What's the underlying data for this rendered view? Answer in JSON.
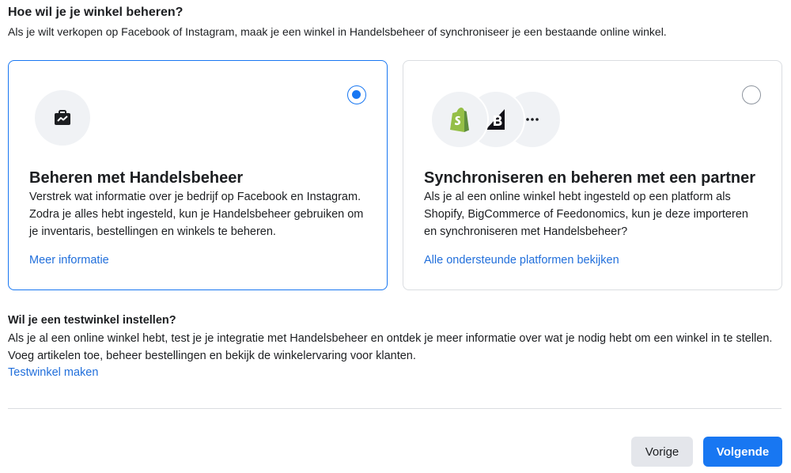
{
  "header": {
    "title": "Hoe wil je je winkel beheren?",
    "subtitle": "Als je wilt verkopen op Facebook of Instagram, maak je een winkel in Handelsbeheer of synchroniseer je een bestaande online winkel."
  },
  "options": [
    {
      "title": "Beheren met Handelsbeheer",
      "description": "Verstrek wat informatie over je bedrijf op Facebook en Instagram. Zodra je alles hebt ingesteld, kun je Handelsbeheer gebruiken om je inventaris, bestellingen en winkels te beheren.",
      "link": "Meer informatie",
      "selected": true
    },
    {
      "title": "Synchroniseren en beheren met een partner",
      "description": "Als je al een online winkel hebt ingesteld op een platform als Shopify, BigCommerce of Feedonomics, kun je deze importeren en synchroniseren met Handelsbeheer?",
      "link": "Alle ondersteunde platformen bekijken",
      "selected": false
    }
  ],
  "test_store": {
    "title": "Wil je een testwinkel instellen?",
    "description": "Als je al een online winkel hebt, test je je integratie met Handelsbeheer en ontdek je meer informatie over wat je nodig hebt om een winkel in te stellen. Voeg artikelen toe, beheer bestellingen en bekijk de winkelervaring voor klanten.",
    "link": "Testwinkel maken"
  },
  "footer": {
    "prev_label": "Vorige",
    "next_label": "Volgende"
  },
  "icons": {
    "commerce": "briefcase-chart-icon",
    "partners": [
      "shopify-icon",
      "bigcommerce-icon",
      "more-icon"
    ]
  },
  "colors": {
    "accent": "#1877f2",
    "link": "#216fdb",
    "shopify_green": "#95bf47"
  }
}
